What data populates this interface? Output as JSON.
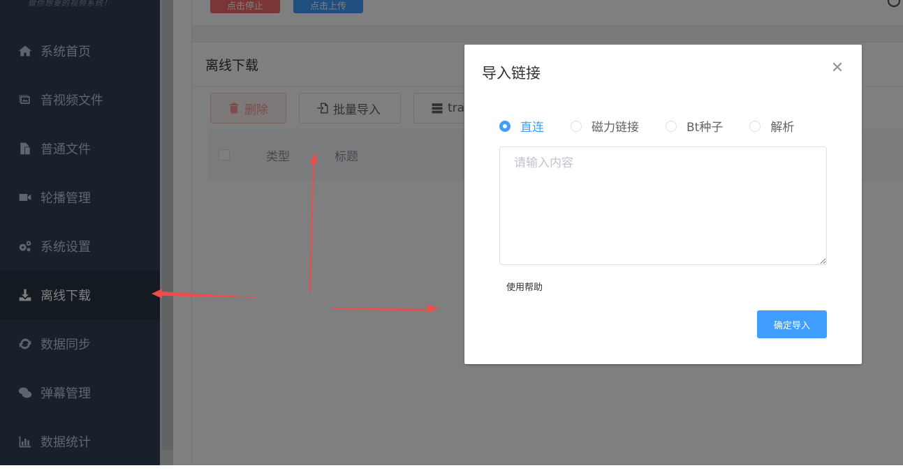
{
  "sidebar": {
    "slogan": "做你想要的视频系统！",
    "items": [
      {
        "label": "系统首页",
        "icon": "home-icon"
      },
      {
        "label": "音视频文件",
        "icon": "media-files-icon"
      },
      {
        "label": "普通文件",
        "icon": "files-icon"
      },
      {
        "label": "轮播管理",
        "icon": "video-camera-icon"
      },
      {
        "label": "系统设置",
        "icon": "gears-icon"
      },
      {
        "label": "离线下载",
        "icon": "download-icon"
      },
      {
        "label": "数据同步",
        "icon": "sync-icon"
      },
      {
        "label": "弹幕管理",
        "icon": "comments-icon"
      },
      {
        "label": "数据统计",
        "icon": "bar-chart-icon"
      }
    ],
    "active_index": 5
  },
  "topbar": {
    "stop_label": "点击停止",
    "upload_label": "点击上传"
  },
  "card": {
    "title": "离线下载",
    "actions": {
      "delete_label": "删除",
      "batch_import_label": "批量导入",
      "tracker_label": "trac"
    },
    "table_headers": [
      "类型",
      "标题"
    ]
  },
  "dialog": {
    "title": "导入链接",
    "radios": [
      {
        "label": "直连",
        "checked": true
      },
      {
        "label": "磁力链接",
        "checked": false
      },
      {
        "label": "Bt种子",
        "checked": false
      },
      {
        "label": "解析",
        "checked": false
      }
    ],
    "textarea_placeholder": "请输入内容",
    "help_label": "使用帮助",
    "confirm_label": "确定导入"
  },
  "colors": {
    "sidebar_bg": "#304156",
    "sidebar_active_bg": "#263445",
    "primary": "#409eff",
    "danger": "#f56c6c",
    "arrow": "#f04b4b"
  }
}
